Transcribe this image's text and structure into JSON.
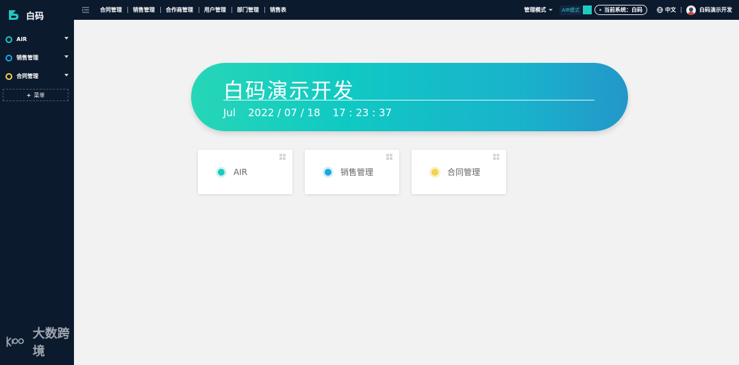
{
  "sidebar": {
    "brand": "白码",
    "items": [
      {
        "label": "AIR",
        "color": "#1fc9c0"
      },
      {
        "label": "销售管理",
        "color": "#1aa7e0"
      },
      {
        "label": "合同管理",
        "color": "#f2d34a"
      }
    ],
    "add_menu_label": "菜单",
    "add_menu_icon": "+",
    "watermark": "大数跨境"
  },
  "topbar": {
    "nav": [
      "合同管理",
      "销售管理",
      "合作商管理",
      "用户管理",
      "部门管理",
      "销售表"
    ],
    "mode_label": "管理模式",
    "air_mode_label": "AIR模式",
    "system_label": "当前系统：白码",
    "language": "中文",
    "user_name": "白码演示开发"
  },
  "banner": {
    "title": "白码演示开发",
    "month": "Jul",
    "date": "2022 / 07 / 18",
    "time": "17 : 23 : 37"
  },
  "cards": [
    {
      "label": "AIR",
      "color": "#1fc9c0",
      "ring": "#d3f3f1"
    },
    {
      "label": "销售管理",
      "color": "#1aa7e0",
      "ring": "#d4eef9"
    },
    {
      "label": "合同管理",
      "color": "#f2d34a",
      "ring": "#fcefcc"
    }
  ],
  "colors": {
    "sidebar_bg": "#0c1a2e",
    "accent": "#1fc9c0"
  }
}
